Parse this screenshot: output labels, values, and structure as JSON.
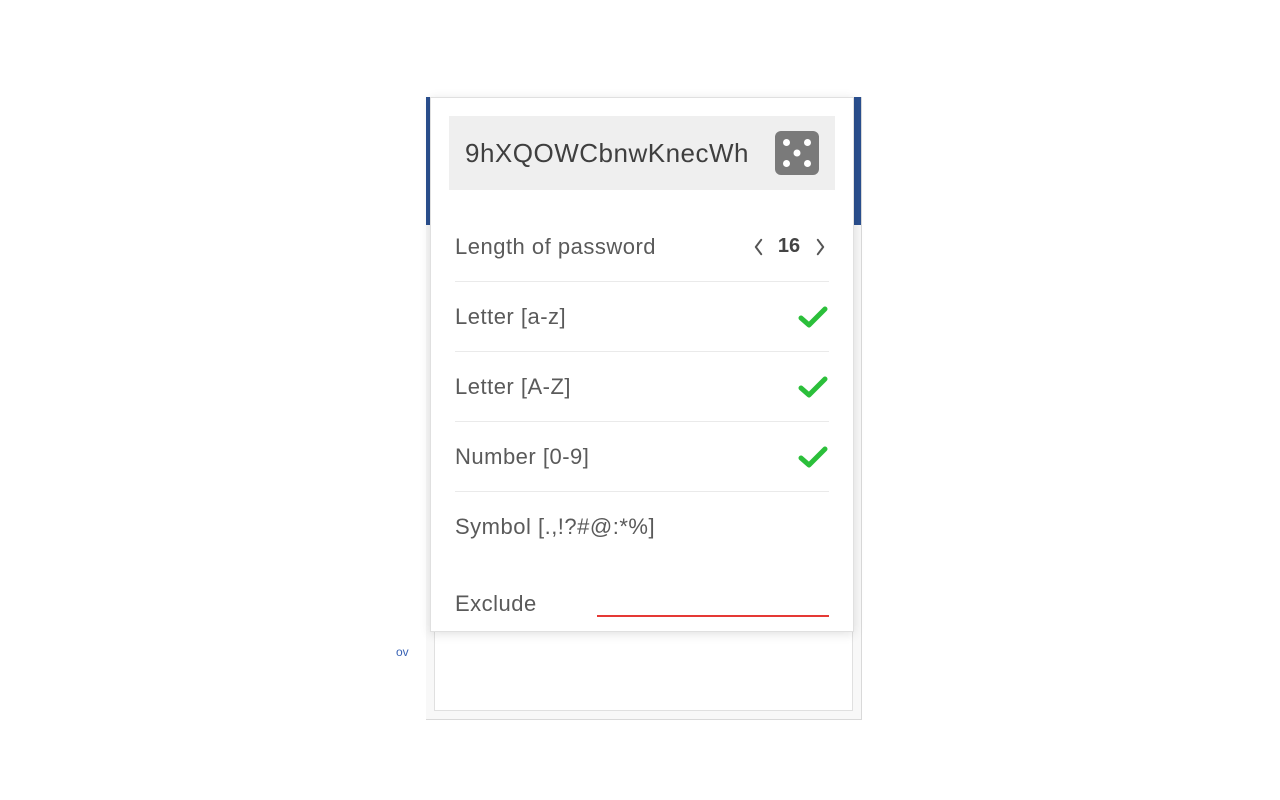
{
  "password": {
    "value": "9hXQOWCbnwKnecWh"
  },
  "stepper": {
    "label": "Length of password",
    "value": "16"
  },
  "options": {
    "lower": {
      "label": "Letter [a-z]",
      "checked": true
    },
    "upper": {
      "label": "Letter [A-Z]",
      "checked": true
    },
    "number": {
      "label": "Number [0-9]",
      "checked": true
    },
    "symbol": {
      "label": "Symbol [.,!?#@:*%]",
      "checked": false
    }
  },
  "exclude": {
    "label": "Exclude",
    "value": ""
  },
  "bg": {
    "ov": "ov"
  },
  "colors": {
    "accent_green": "#2bbf3a",
    "header_blue": "#2a4f8f",
    "error_red": "#e53935"
  }
}
